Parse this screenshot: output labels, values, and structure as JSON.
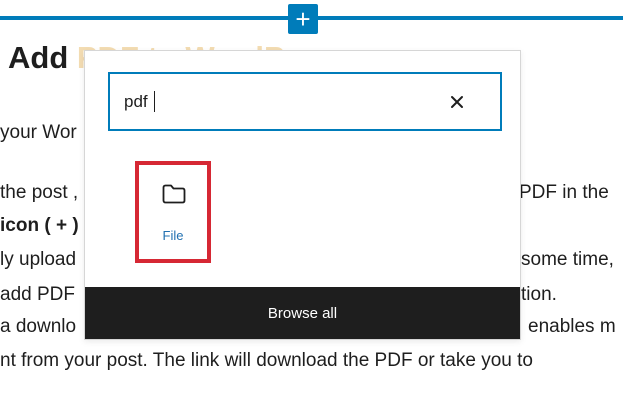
{
  "editor": {
    "title_visible": "Add ",
    "title_faded": "PDF to WordP",
    "lines": [
      "your Wor",
      "the post ,",
      "icon ( + )",
      "ly upload",
      "add PDF",
      "a downlo",
      "nt from your post. The link will download the PDF or take you to"
    ],
    "right_fragments": [
      "PDF in the",
      "some time,",
      "tion.",
      "enables  m"
    ]
  },
  "inserter": {
    "plus_symbol": "+",
    "search": {
      "value": "pdf",
      "clear_symbol": "×"
    },
    "results": [
      {
        "label": "File",
        "icon": "folder-icon"
      }
    ],
    "browse_all_label": "Browse all"
  },
  "colors": {
    "accent": "#007cba",
    "highlight_border": "#d62834",
    "browse_bg": "#1e1e1e",
    "link_text": "#2271b1"
  }
}
